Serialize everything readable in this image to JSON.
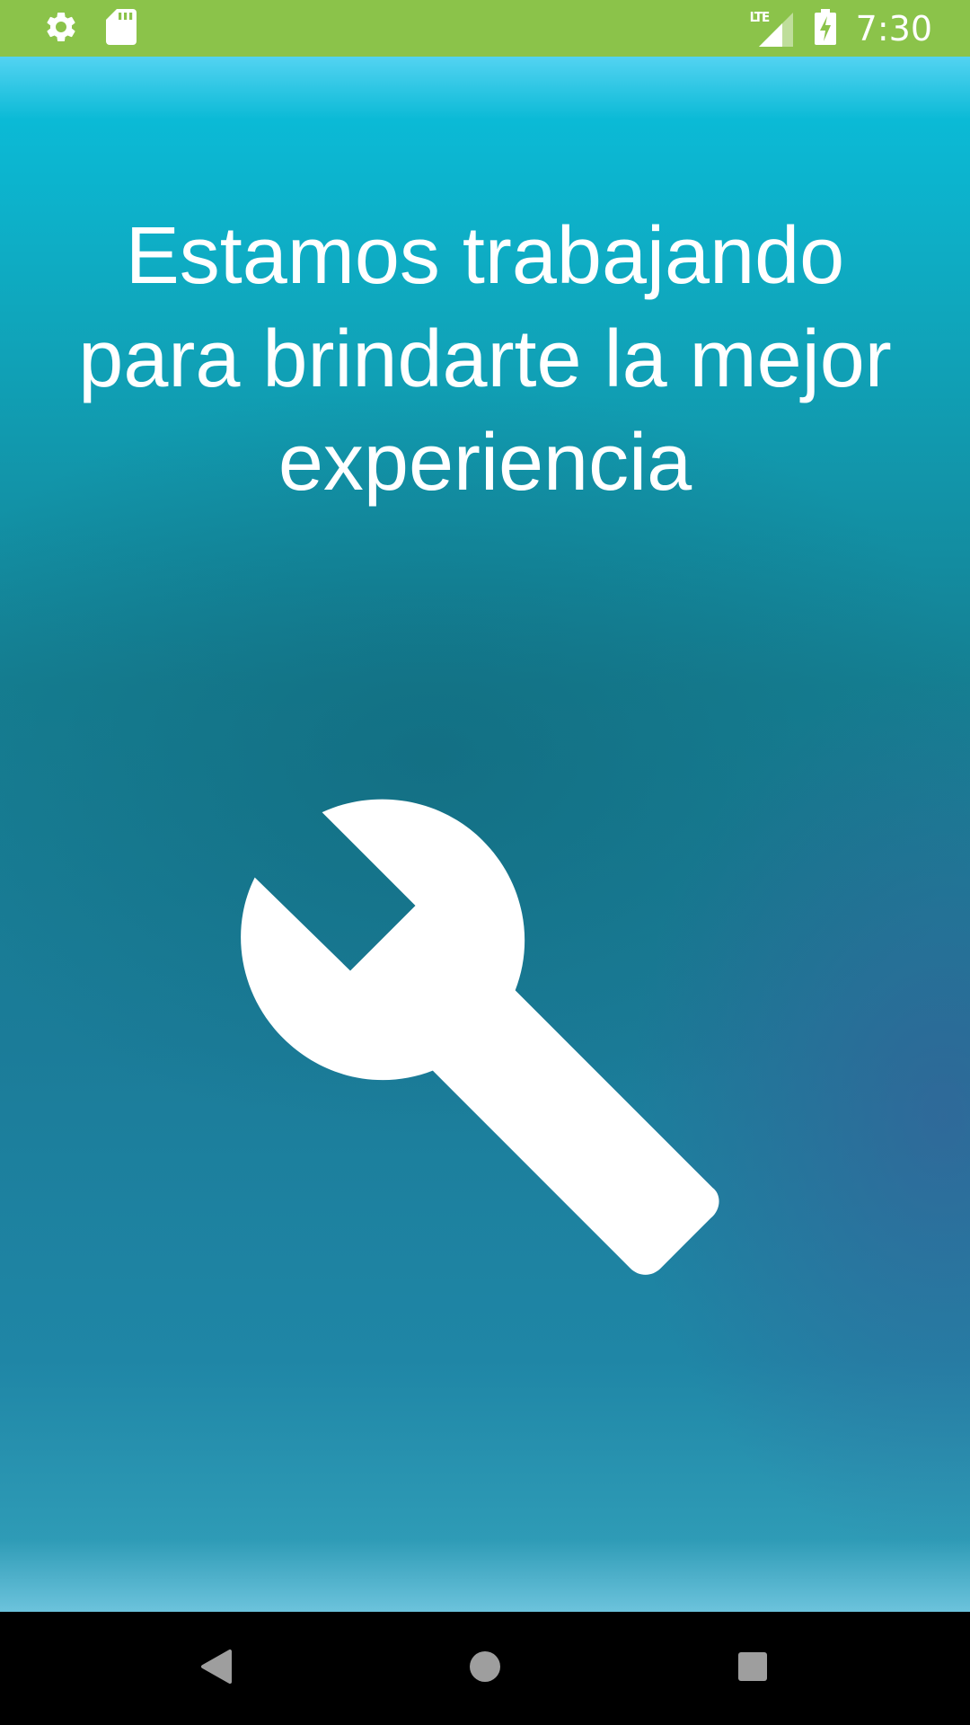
{
  "status_bar": {
    "time": "7:30",
    "network": "LTE",
    "background_color": "#8bc34a",
    "left_icons": [
      "gear-icon",
      "sd-card-icon"
    ],
    "right_icons": [
      "lte-signal-icon",
      "battery-charging-icon"
    ]
  },
  "main": {
    "message": "Estamos trabajando para brindarte la mejor experiencia",
    "illustration": "wrench-icon"
  },
  "nav_bar": {
    "buttons": [
      "back-button",
      "home-button",
      "recents-button"
    ]
  }
}
